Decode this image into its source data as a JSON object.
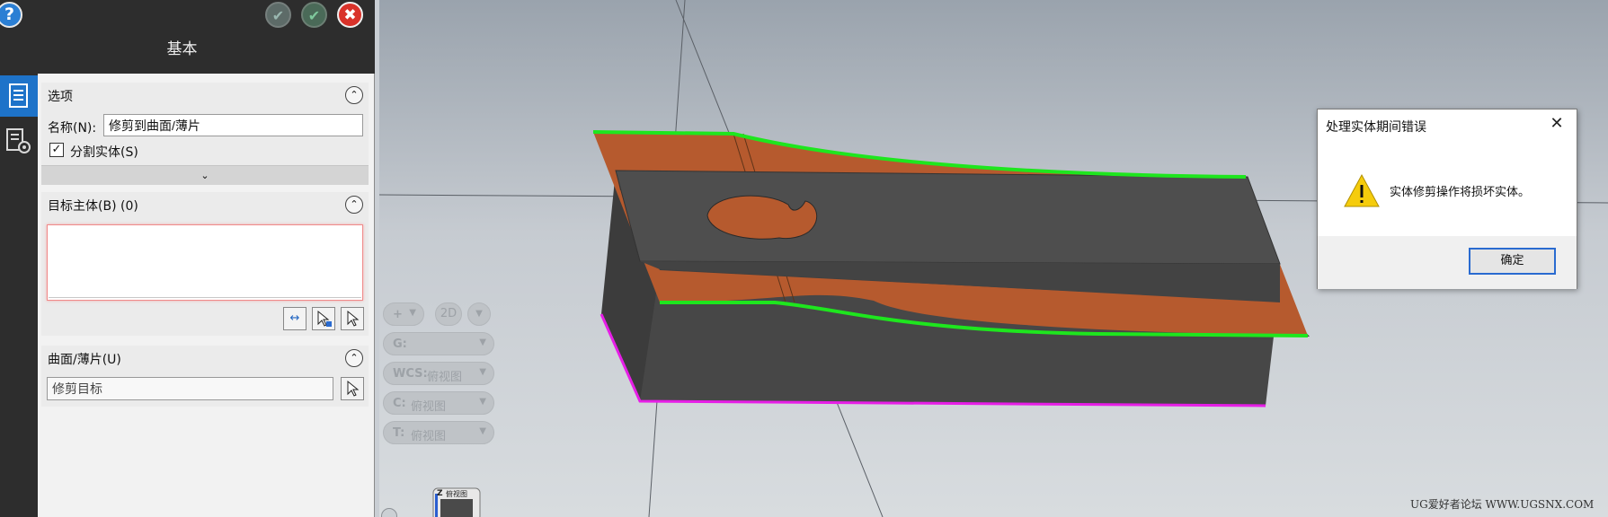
{
  "dialog": {
    "title": "基本",
    "help_label": "?",
    "section_options": {
      "title": "选项",
      "name_label": "名称(N):",
      "name_value": "修剪到曲面/薄片",
      "split_solid_label": "分割实体(S)",
      "split_solid_checked": true
    },
    "section_target": {
      "title": "目标主体(B) (0)"
    },
    "section_surface": {
      "title": "曲面/薄片(U)",
      "input_value": "修剪目标"
    }
  },
  "viewport": {
    "controls": {
      "view_mode": "2D",
      "g_key": "G:",
      "wcs_key": "WCS:",
      "wcs_value": "俯视图",
      "c_key": "C:",
      "c_value": "俯视图",
      "t_key": "T:",
      "t_value": "俯视图"
    },
    "view_cube_axis": "Z",
    "view_cube_label": "俯视图",
    "watermark": "UG爱好者论坛 WWW.UGSNX.COM"
  },
  "error_dialog": {
    "title": "处理实体期间错误",
    "message": "实体修剪操作将损坏实体。",
    "ok_label": "确定"
  },
  "colors": {
    "panel_header": "#2d2d2d",
    "active_tab": "#1e73c9",
    "target_box_border": "#f08a8a",
    "body_dark": "#474747",
    "sheet_orange": "#b65a2e",
    "edge_green": "#1ee61e",
    "edge_magenta": "#e61ee6",
    "ok_button_border": "#2a6bd0"
  }
}
